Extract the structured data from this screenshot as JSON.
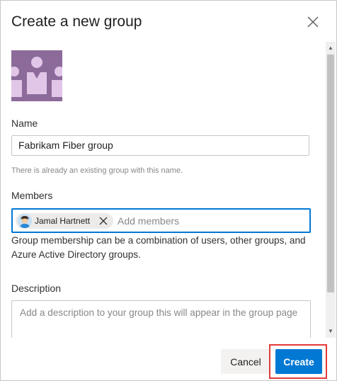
{
  "dialog": {
    "title": "Create a new group"
  },
  "form": {
    "name_label": "Name",
    "name_value": "Fabrikam Fiber group",
    "name_error": "There is already an existing group with this name.",
    "members_label": "Members",
    "members": [
      {
        "name": "Jamal Hartnett"
      }
    ],
    "members_placeholder": "Add members",
    "members_help": "Group membership can be a combination of users, other groups, and Azure Active Directory groups.",
    "description_label": "Description",
    "description_placeholder": "Add a description to your group this will appear in the group page"
  },
  "footer": {
    "cancel_label": "Cancel",
    "create_label": "Create"
  },
  "icons": {
    "close": "close-icon",
    "group_avatar": "group-avatar-icon",
    "remove_member": "close-icon",
    "scroll_up": "scroll-up-arrow-icon",
    "scroll_down": "scroll-down-arrow-icon"
  },
  "colors": {
    "accent": "#0078d4",
    "avatar_bg": "#8c6b9a",
    "avatar_figures": "#e2c6e8",
    "highlight": "#e23a3a"
  }
}
